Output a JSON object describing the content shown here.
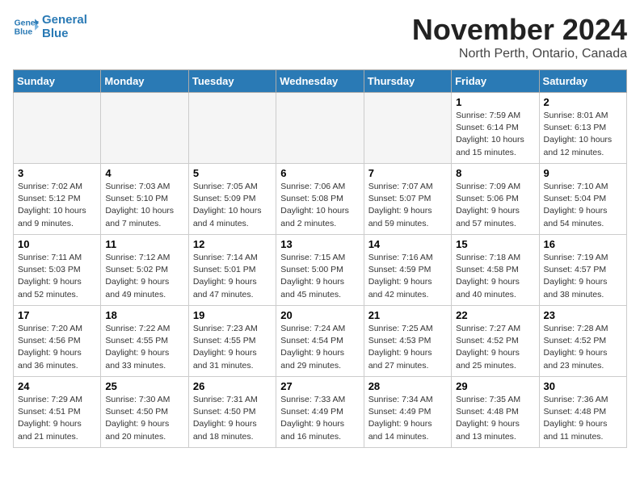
{
  "app": {
    "logo_line1": "General",
    "logo_line2": "Blue"
  },
  "header": {
    "month_year": "November 2024",
    "location": "North Perth, Ontario, Canada"
  },
  "weekdays": [
    "Sunday",
    "Monday",
    "Tuesday",
    "Wednesday",
    "Thursday",
    "Friday",
    "Saturday"
  ],
  "weeks": [
    [
      {
        "day": "",
        "empty": true
      },
      {
        "day": "",
        "empty": true
      },
      {
        "day": "",
        "empty": true
      },
      {
        "day": "",
        "empty": true
      },
      {
        "day": "",
        "empty": true
      },
      {
        "day": "1",
        "sunrise": "7:59 AM",
        "sunset": "6:14 PM",
        "daylight": "10 hours and 15 minutes."
      },
      {
        "day": "2",
        "sunrise": "8:01 AM",
        "sunset": "6:13 PM",
        "daylight": "10 hours and 12 minutes."
      }
    ],
    [
      {
        "day": "3",
        "sunrise": "7:02 AM",
        "sunset": "5:12 PM",
        "daylight": "10 hours and 9 minutes."
      },
      {
        "day": "4",
        "sunrise": "7:03 AM",
        "sunset": "5:10 PM",
        "daylight": "10 hours and 7 minutes."
      },
      {
        "day": "5",
        "sunrise": "7:05 AM",
        "sunset": "5:09 PM",
        "daylight": "10 hours and 4 minutes."
      },
      {
        "day": "6",
        "sunrise": "7:06 AM",
        "sunset": "5:08 PM",
        "daylight": "10 hours and 2 minutes."
      },
      {
        "day": "7",
        "sunrise": "7:07 AM",
        "sunset": "5:07 PM",
        "daylight": "9 hours and 59 minutes."
      },
      {
        "day": "8",
        "sunrise": "7:09 AM",
        "sunset": "5:06 PM",
        "daylight": "9 hours and 57 minutes."
      },
      {
        "day": "9",
        "sunrise": "7:10 AM",
        "sunset": "5:04 PM",
        "daylight": "9 hours and 54 minutes."
      }
    ],
    [
      {
        "day": "10",
        "sunrise": "7:11 AM",
        "sunset": "5:03 PM",
        "daylight": "9 hours and 52 minutes."
      },
      {
        "day": "11",
        "sunrise": "7:12 AM",
        "sunset": "5:02 PM",
        "daylight": "9 hours and 49 minutes."
      },
      {
        "day": "12",
        "sunrise": "7:14 AM",
        "sunset": "5:01 PM",
        "daylight": "9 hours and 47 minutes."
      },
      {
        "day": "13",
        "sunrise": "7:15 AM",
        "sunset": "5:00 PM",
        "daylight": "9 hours and 45 minutes."
      },
      {
        "day": "14",
        "sunrise": "7:16 AM",
        "sunset": "4:59 PM",
        "daylight": "9 hours and 42 minutes."
      },
      {
        "day": "15",
        "sunrise": "7:18 AM",
        "sunset": "4:58 PM",
        "daylight": "9 hours and 40 minutes."
      },
      {
        "day": "16",
        "sunrise": "7:19 AM",
        "sunset": "4:57 PM",
        "daylight": "9 hours and 38 minutes."
      }
    ],
    [
      {
        "day": "17",
        "sunrise": "7:20 AM",
        "sunset": "4:56 PM",
        "daylight": "9 hours and 36 minutes."
      },
      {
        "day": "18",
        "sunrise": "7:22 AM",
        "sunset": "4:55 PM",
        "daylight": "9 hours and 33 minutes."
      },
      {
        "day": "19",
        "sunrise": "7:23 AM",
        "sunset": "4:55 PM",
        "daylight": "9 hours and 31 minutes."
      },
      {
        "day": "20",
        "sunrise": "7:24 AM",
        "sunset": "4:54 PM",
        "daylight": "9 hours and 29 minutes."
      },
      {
        "day": "21",
        "sunrise": "7:25 AM",
        "sunset": "4:53 PM",
        "daylight": "9 hours and 27 minutes."
      },
      {
        "day": "22",
        "sunrise": "7:27 AM",
        "sunset": "4:52 PM",
        "daylight": "9 hours and 25 minutes."
      },
      {
        "day": "23",
        "sunrise": "7:28 AM",
        "sunset": "4:52 PM",
        "daylight": "9 hours and 23 minutes."
      }
    ],
    [
      {
        "day": "24",
        "sunrise": "7:29 AM",
        "sunset": "4:51 PM",
        "daylight": "9 hours and 21 minutes."
      },
      {
        "day": "25",
        "sunrise": "7:30 AM",
        "sunset": "4:50 PM",
        "daylight": "9 hours and 20 minutes."
      },
      {
        "day": "26",
        "sunrise": "7:31 AM",
        "sunset": "4:50 PM",
        "daylight": "9 hours and 18 minutes."
      },
      {
        "day": "27",
        "sunrise": "7:33 AM",
        "sunset": "4:49 PM",
        "daylight": "9 hours and 16 minutes."
      },
      {
        "day": "28",
        "sunrise": "7:34 AM",
        "sunset": "4:49 PM",
        "daylight": "9 hours and 14 minutes."
      },
      {
        "day": "29",
        "sunrise": "7:35 AM",
        "sunset": "4:48 PM",
        "daylight": "9 hours and 13 minutes."
      },
      {
        "day": "30",
        "sunrise": "7:36 AM",
        "sunset": "4:48 PM",
        "daylight": "9 hours and 11 minutes."
      }
    ]
  ]
}
